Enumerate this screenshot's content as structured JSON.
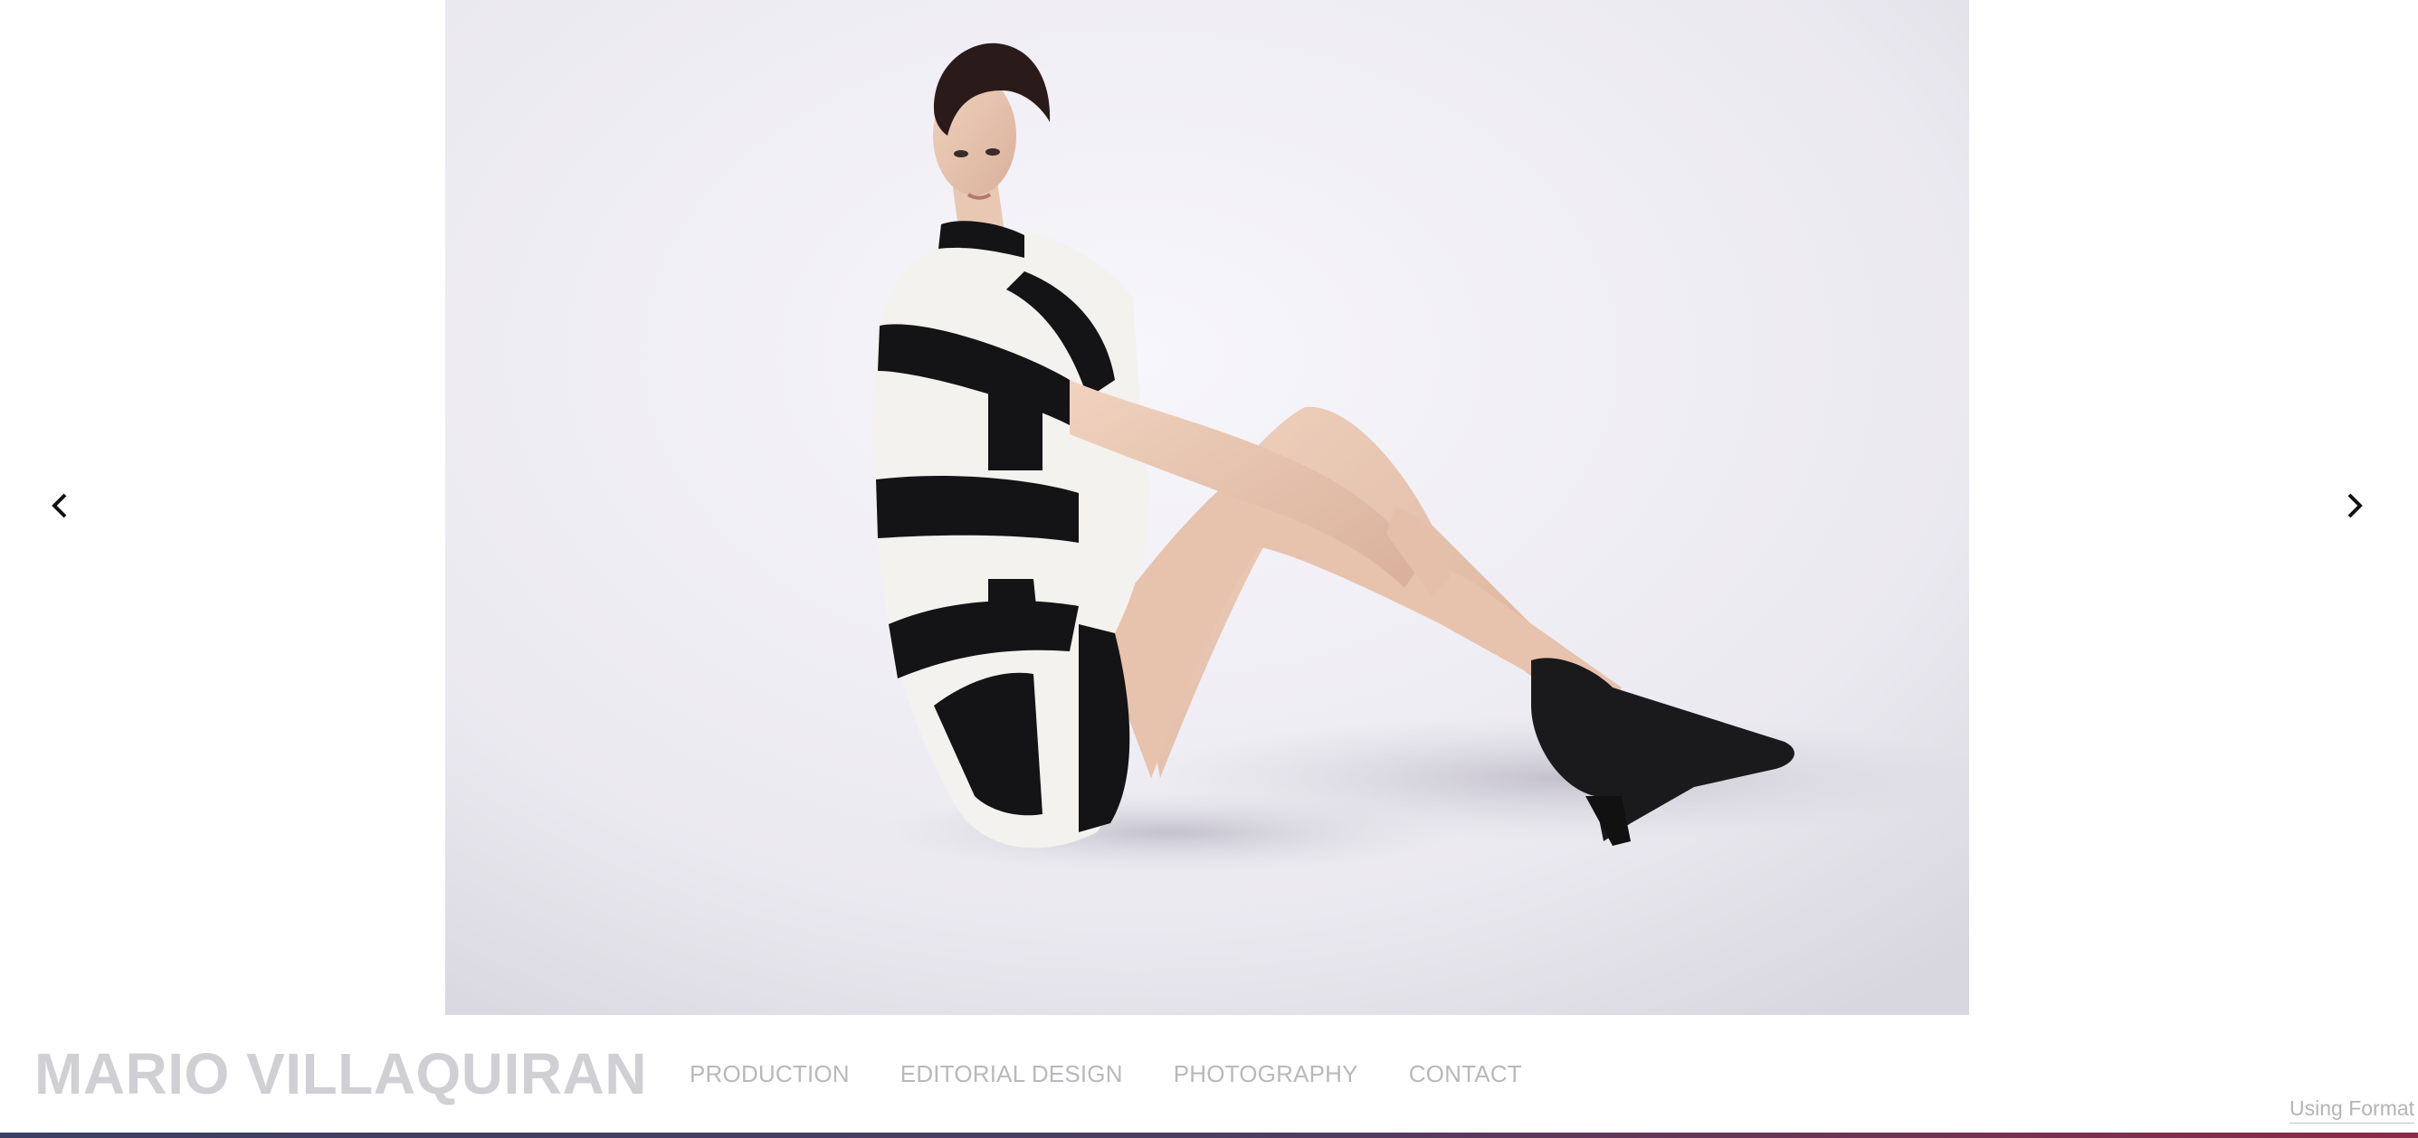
{
  "site": {
    "title": "MARIO VILLAQUIRAN"
  },
  "navigation": {
    "items": [
      {
        "label": "PRODUCTION"
      },
      {
        "label": "EDITORIAL DESIGN"
      },
      {
        "label": "PHOTOGRAPHY"
      },
      {
        "label": "CONTACT"
      }
    ]
  },
  "gallery": {
    "prev_icon": "chevron-left-icon",
    "next_icon": "chevron-right-icon"
  },
  "footer": {
    "credit": "Using Format"
  },
  "colors": {
    "title": "#cfcfd4",
    "nav_text": "#b8b8bd",
    "background": "#ffffff",
    "accent_bar_start": "#3c3f63",
    "accent_bar_end": "#8a2c48"
  }
}
